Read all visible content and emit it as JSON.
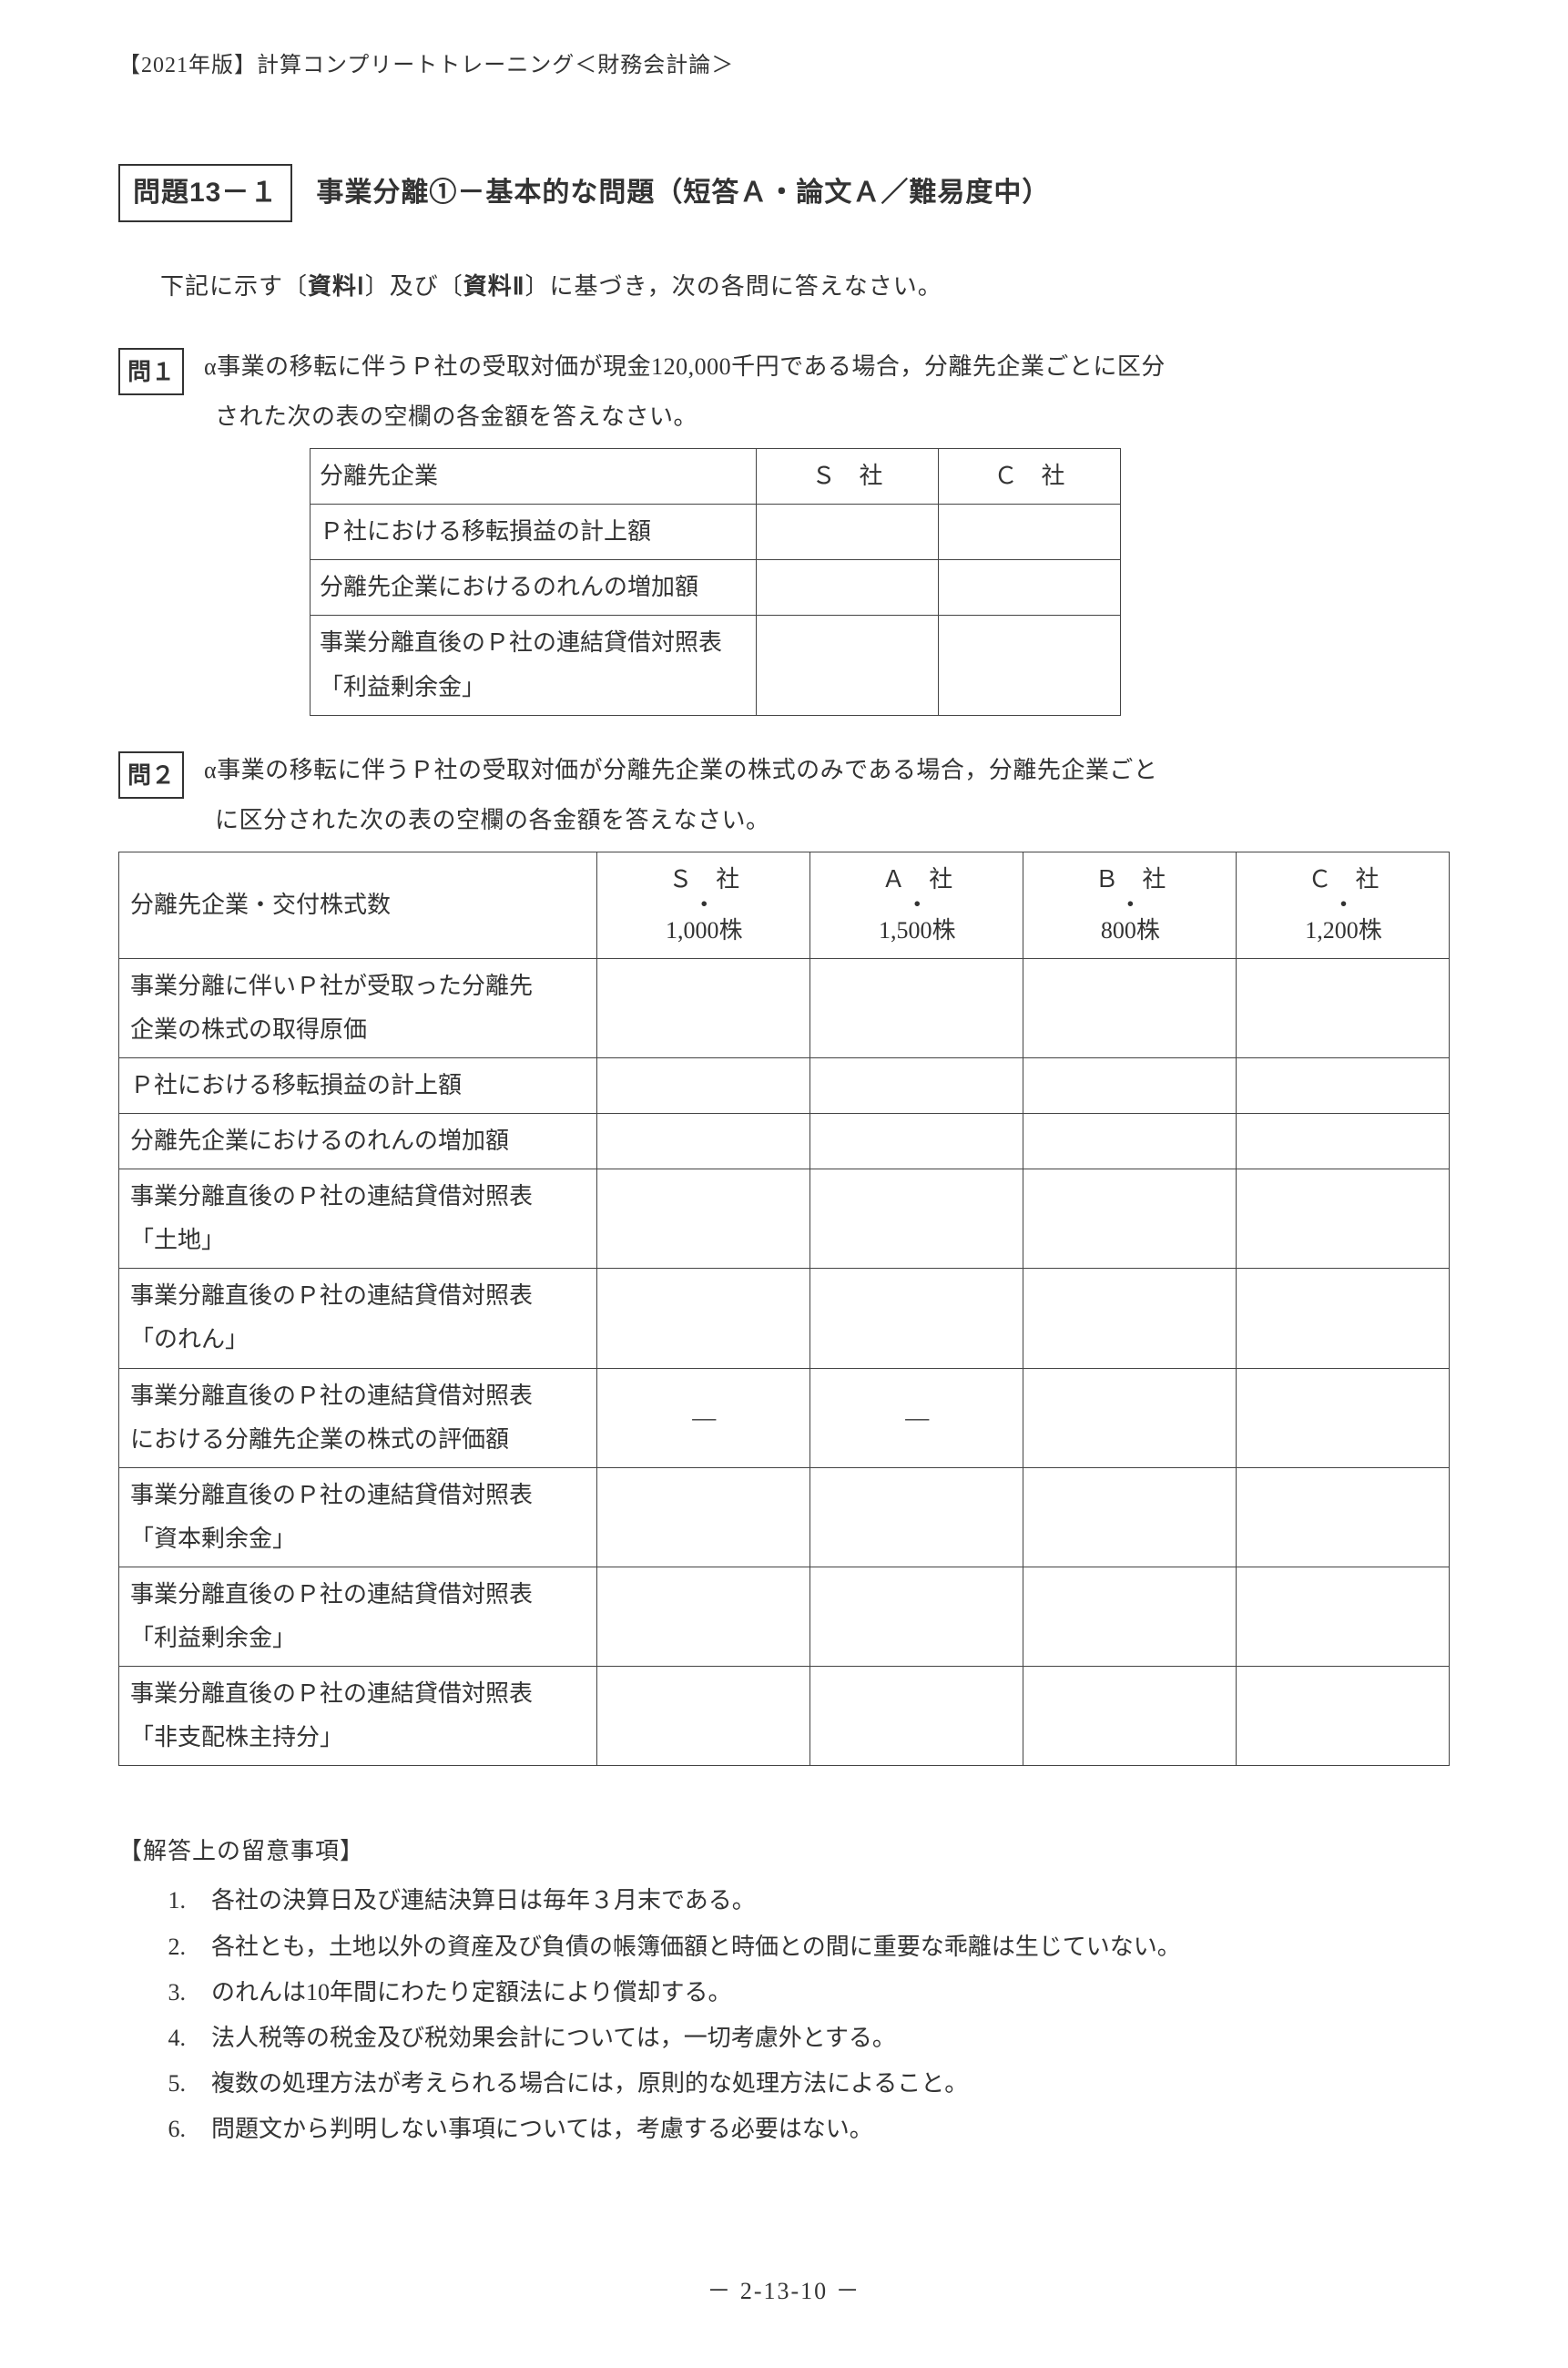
{
  "header": "【2021年版】計算コンプリートトレーニング＜財務会計論＞",
  "title": {
    "problem_num": "問題13－１",
    "text": "事業分離①－基本的な問題（短答Ａ・論文Ａ／難易度中）"
  },
  "intro": {
    "pre": "下記に示す〔",
    "b1": "資料Ⅰ",
    "mid": "〕及び〔",
    "b2": "資料Ⅱ",
    "post": "〕に基づき，次の各問に答えなさい。"
  },
  "q1": {
    "num": "問１",
    "line1": "α事業の移転に伴うＰ社の受取対価が現金120,000千円である場合，分離先企業ごとに区分",
    "line2": "された次の表の空欄の各金額を答えなさい。"
  },
  "table1": {
    "h0": "分離先企業",
    "h1": "Ｓ　社",
    "h2": "Ｃ　社",
    "r1": "Ｐ社における移転損益の計上額",
    "r2": "分離先企業におけるのれんの増加額",
    "r3a": "事業分離直後のＰ社の連結貸借対照表",
    "r3b": "「利益剰余金」"
  },
  "q2": {
    "num": "問２",
    "line1": "α事業の移転に伴うＰ社の受取対価が分離先企業の株式のみである場合，分離先企業ごと",
    "line2": "に区分された次の表の空欄の各金額を答えなさい。"
  },
  "table2": {
    "h0": "分離先企業・交付株式数",
    "cols": [
      {
        "name": "Ｓ　社",
        "shares": "1,000株"
      },
      {
        "name": "Ａ　社",
        "shares": "1,500株"
      },
      {
        "name": "Ｂ　社",
        "shares": "800株"
      },
      {
        "name": "Ｃ　社",
        "shares": "1,200株"
      }
    ],
    "rows": [
      {
        "l1": "事業分離に伴いＰ社が受取った分離先",
        "l2": "企業の株式の取得原価",
        "dash": [
          false,
          false,
          false,
          false
        ]
      },
      {
        "l1": "Ｐ社における移転損益の計上額",
        "l2": "",
        "dash": [
          false,
          false,
          false,
          false
        ]
      },
      {
        "l1": "分離先企業におけるのれんの増加額",
        "l2": "",
        "dash": [
          false,
          false,
          false,
          false
        ]
      },
      {
        "l1": "事業分離直後のＰ社の連結貸借対照表",
        "l2": "「土地」",
        "dash": [
          false,
          false,
          false,
          false
        ]
      },
      {
        "l1": "事業分離直後のＰ社の連結貸借対照表",
        "l2": "「のれん」",
        "dash": [
          false,
          false,
          false,
          false
        ]
      },
      {
        "l1": "事業分離直後のＰ社の連結貸借対照表",
        "l2": "における分離先企業の株式の評価額",
        "dash": [
          true,
          true,
          false,
          false
        ]
      },
      {
        "l1": "事業分離直後のＰ社の連結貸借対照表",
        "l2": "「資本剰余金」",
        "dash": [
          false,
          false,
          false,
          false
        ]
      },
      {
        "l1": "事業分離直後のＰ社の連結貸借対照表",
        "l2": "「利益剰余金」",
        "dash": [
          false,
          false,
          false,
          false
        ]
      },
      {
        "l1": "事業分離直後のＰ社の連結貸借対照表",
        "l2": "「非支配株主持分」",
        "dash": [
          false,
          false,
          false,
          false
        ]
      }
    ]
  },
  "notes": {
    "title": "【解答上の留意事項】",
    "items": [
      "各社の決算日及び連結決算日は毎年３月末である。",
      "各社とも，土地以外の資産及び負債の帳簿価額と時価との間に重要な乖離は生じていない。",
      "のれんは10年間にわたり定額法により償却する。",
      "法人税等の税金及び税効果会計については，一切考慮外とする。",
      "複数の処理方法が考えられる場合には，原則的な処理方法によること。",
      "問題文から判明しない事項については，考慮する必要はない。"
    ]
  },
  "footer": "－  2-13-10  －",
  "dash_char": "―"
}
